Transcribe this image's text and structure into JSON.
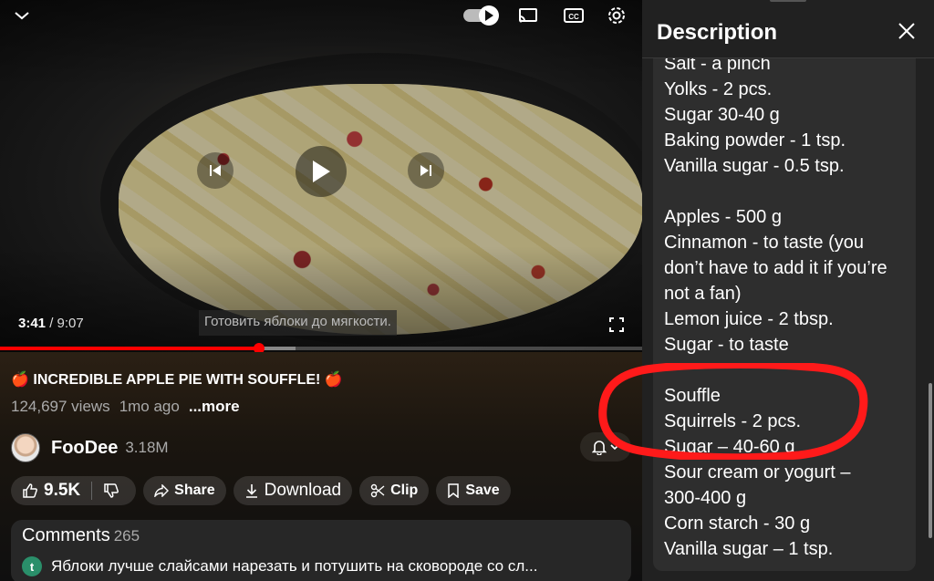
{
  "player": {
    "current_time": "3:41",
    "duration": "9:07",
    "subtitle": "Готовить яблоки до мягкости.",
    "progress": {
      "played_fraction": 0.404,
      "buffered_fraction": 0.46
    }
  },
  "video": {
    "title": "🍎 INCREDIBLE APPLE PIE WITH SOUFFLE! 🍎",
    "views": "124,697 views",
    "age": "1mo ago",
    "more_label": "...more"
  },
  "channel": {
    "name": "FooDee",
    "subscribers": "3.18M"
  },
  "actions": {
    "like_count": "9.5K",
    "share_label": "Share",
    "download_label": "Download",
    "clip_label": "Clip",
    "save_label": "Save"
  },
  "comments": {
    "label": "Comments",
    "count": "265",
    "first_author_initial": "t",
    "first_text": "Яблоки лучше слайсами нарезать и потушить на сковороде со сл..."
  },
  "description_panel": {
    "title": "Description",
    "lines": [
      "Salt - a pinch",
      "Yolks - 2 pcs.",
      "Sugar 30-40 g",
      "Baking powder - 1 tsp.",
      "Vanilla sugar - 0.5 tsp.",
      "",
      "Apples - 500 g",
      "Cinnamon - to taste (you",
      "don’t have to add it if you’re",
      "not a fan)",
      "Lemon juice - 2 tbsp.",
      "Sugar - to taste",
      "",
      "Souffle",
      "Squirrels - 2 pcs.",
      "Sugar – 40-60 g",
      "Sour cream or yogurt –",
      "300-400 g",
      "Corn starch - 30 g",
      "Vanilla sugar – 1 tsp."
    ]
  },
  "colors": {
    "progress_red": "#ff0000",
    "annotation_red": "#ff1a1a",
    "panel_bg": "#212121"
  }
}
